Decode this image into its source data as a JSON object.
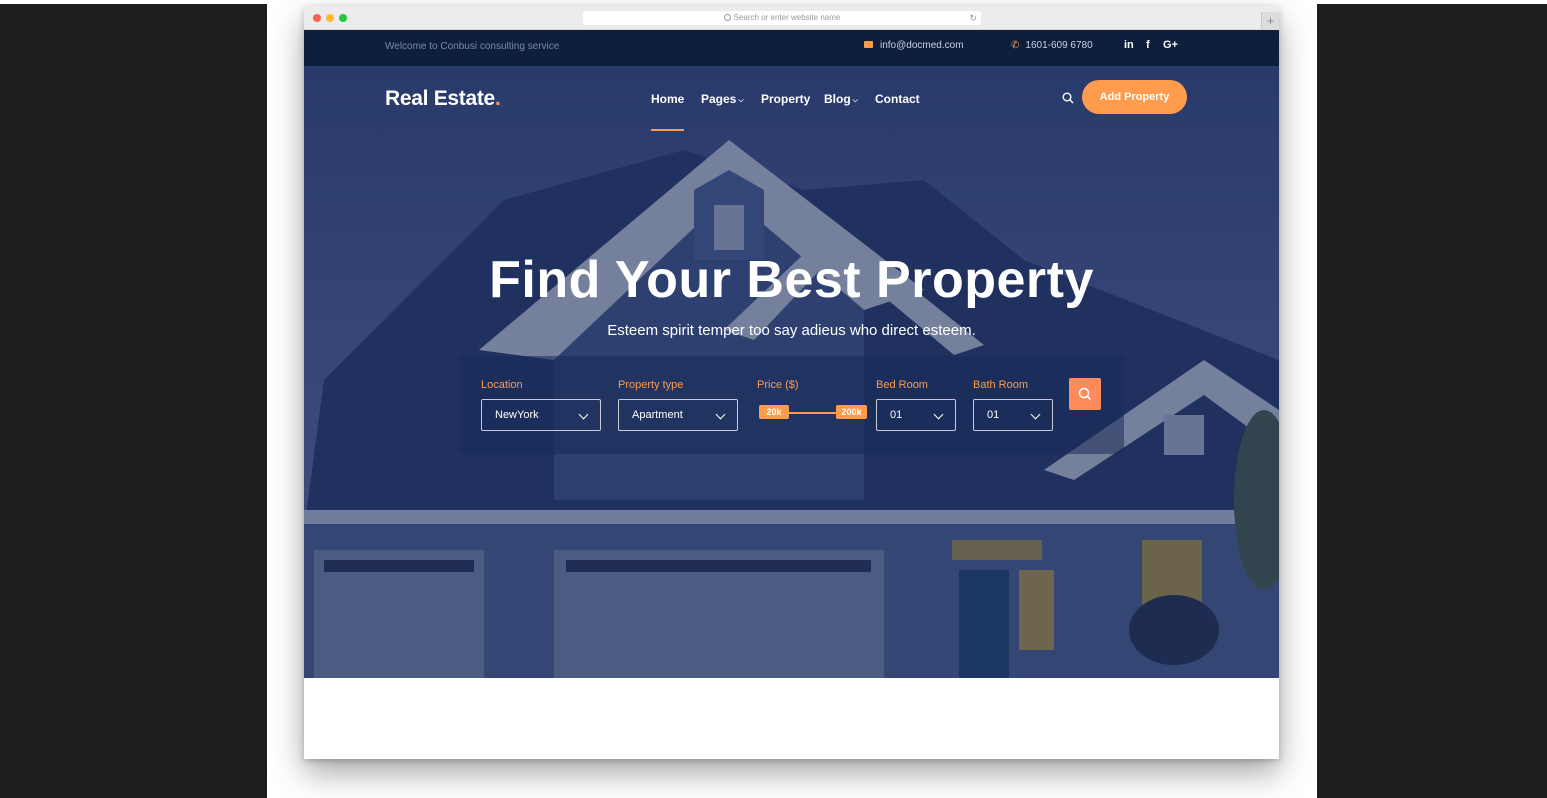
{
  "browser": {
    "url_placeholder": "Search or enter website name",
    "reload_icon": "reload-icon",
    "new_tab_label": "+"
  },
  "topbar": {
    "welcome": "Welcome to Conbusi consulting service",
    "email": "info@docmed.com",
    "phone": "1601-609 6780",
    "social": {
      "linkedin": "in",
      "facebook": "f",
      "google": "G+"
    }
  },
  "header": {
    "logo_text": "Real Estate",
    "logo_dot": ".",
    "nav": {
      "home": "Home",
      "pages": "Pages",
      "property": "Property",
      "blog": "Blog",
      "contact": "Contact"
    },
    "add_property": "Add Property"
  },
  "hero": {
    "title": "Find Your Best Property",
    "subtitle": "Esteem spirit temper too say adieus who direct esteem."
  },
  "search": {
    "location": {
      "label": "Location",
      "value": "NewYork"
    },
    "property_type": {
      "label": "Property type",
      "value": "Apartment"
    },
    "price": {
      "label": "Price ($)",
      "min": "20k",
      "max": "200k"
    },
    "bed_room": {
      "label": "Bed Room",
      "value": "01"
    },
    "bath_room": {
      "label": "Bath Room",
      "value": "01"
    }
  },
  "colors": {
    "accent": "#ff9b4d",
    "topbar_bg": "#0d1f3c",
    "overlay": "#162652"
  }
}
